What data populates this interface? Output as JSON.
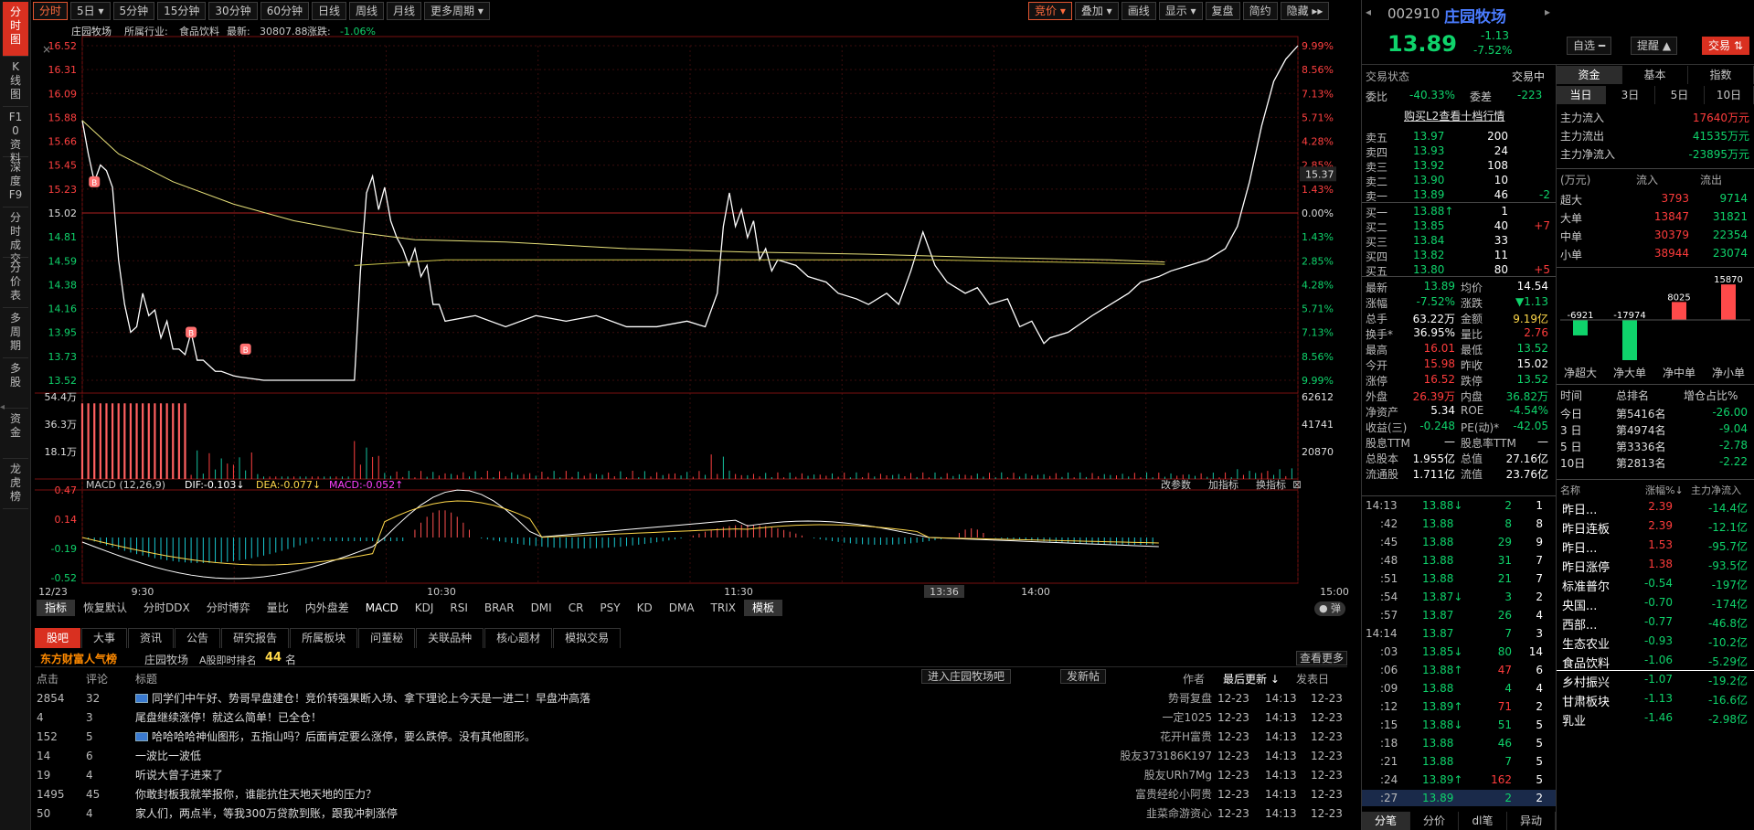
{
  "left_nav": [
    "分时图",
    "K线图",
    "F10资料",
    "深度F9",
    "分时成交",
    "分价表",
    "多周期",
    "多股",
    "资金",
    "龙虎榜"
  ],
  "toolbar": {
    "periods": [
      "分时",
      "5日 ▾",
      "5分钟",
      "15分钟",
      "30分钟",
      "60分钟",
      "日线",
      "周线",
      "月线",
      "更多周期 ▾"
    ],
    "right": [
      "竞价 ▾",
      "叠加 ▾",
      "画线",
      "显示 ▾",
      "复盘",
      "简约",
      "隐藏 ▸▸"
    ]
  },
  "chart_data": {
    "type": "line",
    "header": {
      "name": "庄园牧场",
      "industry_label": "所属行业:",
      "industry": "食品饮料",
      "latest_label": "最新:",
      "latest": "30807.88",
      "chg_label": "涨跌:",
      "chg": "-1.06%"
    },
    "price_ticks": [
      "16.52",
      "16.31",
      "16.09",
      "15.88",
      "15.66",
      "15.45",
      "15.23",
      "15.02",
      "14.81",
      "14.59",
      "14.38",
      "14.16",
      "13.95",
      "13.73",
      "13.52"
    ],
    "pct_ticks": [
      "9.99%",
      "8.56%",
      "7.13%",
      "5.71%",
      "4.28%",
      "2.85%",
      "1.43%",
      "0.00%",
      "1.43%",
      "2.85%",
      "4.28%",
      "5.71%",
      "7.13%",
      "8.56%",
      "9.99%"
    ],
    "ylim": [
      13.52,
      16.52
    ],
    "prev_close": 15.02,
    "cursor_label": "15.37",
    "vol_ticks": [
      "54.4万",
      "36.3万",
      "18.1万"
    ],
    "vol_right_ticks": [
      "62612",
      "41741",
      "20870"
    ],
    "macd": {
      "label": "MACD (12,26,9)",
      "dif": "DIF:-0.103↓",
      "dea": "DEA:-0.077↓",
      "macd": "MACD:-0.052↑",
      "ticks": [
        "0.47",
        "0.14",
        "-0.19",
        "-0.52"
      ],
      "links": [
        "改参数",
        "加指标",
        "换指标"
      ]
    },
    "x_labels": [
      "12/23",
      "9:30",
      "10:30",
      "11:30",
      "13:36",
      "14:00",
      "15:00"
    ],
    "series": [
      {
        "values": [
          [
            0,
            15.85
          ],
          [
            2,
            15.55
          ],
          [
            4,
            15.3
          ],
          [
            6,
            15.45
          ],
          [
            8,
            15.4
          ],
          [
            10,
            15.25
          ],
          [
            12,
            14.6
          ],
          [
            14,
            14.2
          ],
          [
            16,
            13.95
          ],
          [
            18,
            14.0
          ],
          [
            20,
            14.3
          ],
          [
            22,
            14.1
          ],
          [
            24,
            14.15
          ],
          [
            26,
            13.9
          ],
          [
            28,
            14.05
          ],
          [
            30,
            13.8
          ],
          [
            32,
            13.8
          ],
          [
            34,
            13.75
          ],
          [
            36,
            13.95
          ],
          [
            38,
            13.7
          ],
          [
            40,
            13.7
          ],
          [
            42,
            13.65
          ],
          [
            44,
            13.6
          ],
          [
            46,
            13.6
          ],
          [
            48,
            13.58
          ],
          [
            50,
            13.56
          ],
          [
            52,
            13.55
          ],
          [
            60,
            13.52
          ],
          [
            90,
            13.52
          ],
          [
            92,
            14.5
          ],
          [
            94,
            15.2
          ],
          [
            96,
            15.35
          ],
          [
            98,
            15.05
          ],
          [
            100,
            15.25
          ],
          [
            102,
            14.95
          ],
          [
            104,
            14.8
          ],
          [
            106,
            14.7
          ],
          [
            108,
            14.55
          ],
          [
            110,
            14.7
          ],
          [
            112,
            14.45
          ],
          [
            114,
            14.55
          ],
          [
            116,
            14.2
          ],
          [
            118,
            14.2
          ],
          [
            120,
            14.05
          ],
          [
            130,
            14.1
          ],
          [
            140,
            14.0
          ],
          [
            150,
            14.1
          ],
          [
            160,
            14.05
          ],
          [
            170,
            14.1
          ],
          [
            180,
            14.0
          ],
          [
            190,
            14.0
          ],
          [
            200,
            14.05
          ],
          [
            206,
            14.0
          ],
          [
            210,
            14.3
          ],
          [
            212,
            14.9
          ],
          [
            214,
            15.2
          ],
          [
            216,
            14.9
          ],
          [
            218,
            15.05
          ],
          [
            220,
            14.8
          ],
          [
            222,
            14.95
          ],
          [
            224,
            14.6
          ],
          [
            226,
            14.7
          ],
          [
            228,
            14.5
          ],
          [
            230,
            14.6
          ],
          [
            236,
            14.55
          ],
          [
            240,
            14.45
          ],
          [
            246,
            14.4
          ],
          [
            250,
            14.3
          ],
          [
            256,
            14.25
          ],
          [
            260,
            14.2
          ],
          [
            266,
            14.3
          ],
          [
            270,
            14.2
          ],
          [
            274,
            14.5
          ],
          [
            278,
            14.85
          ],
          [
            282,
            14.55
          ],
          [
            286,
            14.4
          ],
          [
            292,
            14.3
          ],
          [
            296,
            14.35
          ],
          [
            300,
            14.2
          ],
          [
            306,
            14.25
          ],
          [
            310,
            14.0
          ],
          [
            314,
            14.05
          ],
          [
            318,
            13.85
          ],
          [
            320,
            13.9
          ],
          [
            326,
            13.95
          ],
          [
            334,
            14.1
          ],
          [
            340,
            14.2
          ],
          [
            346,
            14.3
          ],
          [
            350,
            14.4
          ],
          [
            356,
            14.45
          ],
          [
            360,
            14.5
          ],
          [
            366,
            14.55
          ],
          [
            372,
            14.6
          ],
          [
            378,
            14.7
          ],
          [
            382,
            14.9
          ],
          [
            386,
            15.3
          ],
          [
            390,
            15.8
          ],
          [
            394,
            16.2
          ],
          [
            398,
            16.4
          ],
          [
            402,
            16.52
          ]
        ]
      },
      {
        "values": [
          [
            0,
            15.85
          ],
          [
            12,
            15.55
          ],
          [
            30,
            15.3
          ],
          [
            50,
            15.1
          ],
          [
            70,
            14.95
          ],
          [
            90,
            14.85
          ],
          [
            110,
            14.78
          ],
          [
            140,
            14.76
          ],
          [
            180,
            14.7
          ],
          [
            220,
            14.67
          ],
          [
            260,
            14.65
          ],
          [
            300,
            14.62
          ],
          [
            340,
            14.6
          ],
          [
            358,
            14.58
          ]
        ]
      },
      {
        "values": [
          [
            90,
            14.55
          ],
          [
            120,
            14.6
          ],
          [
            160,
            14.6
          ],
          [
            200,
            14.6
          ],
          [
            240,
            14.6
          ],
          [
            280,
            14.6
          ],
          [
            320,
            14.58
          ],
          [
            358,
            14.56
          ]
        ]
      }
    ],
    "buy_marks": [
      [
        4,
        15.3
      ],
      [
        36,
        13.95
      ],
      [
        54,
        13.8
      ]
    ]
  },
  "indicator_tabs": [
    "指标",
    "恢复默认",
    "分时DDX",
    "分时博弈",
    "量比",
    "内外盘差",
    "MACD",
    "KDJ",
    "RSI",
    "BRAR",
    "DMI",
    "CR",
    "PSY",
    "KD",
    "DMA",
    "TRIX",
    "模板"
  ],
  "bottom_tabs": [
    "股吧",
    "大事",
    "资讯",
    "公告",
    "研究报告",
    "所属板块",
    "问董秘",
    "关联品种",
    "核心题材",
    "模拟交易"
  ],
  "feed": {
    "brand": "东方财富人气榜",
    "stock": "庄园牧场",
    "rank_label": "A股即时排名",
    "rank": "44",
    "rank_unit": "名",
    "more": "查看更多",
    "headers": [
      "点击",
      "评论",
      "标题",
      "作者",
      "最后更新 ↓",
      "发表日"
    ],
    "enter": "进入庄园牧场吧",
    "post": "发新帖",
    "rows": [
      [
        "2854",
        "32",
        "同学们中午好、势哥早盘建仓！竞价转强果断入场、拿下理论上今天是一进二！早盘冲高落",
        "势哥复盘",
        "12-23",
        "14:13",
        "12-23"
      ],
      [
        "4",
        "3",
        "尾盘继续涨停！就这么简单！已全仓！",
        "一定1025",
        "12-23",
        "14:13",
        "12-23"
      ],
      [
        "152",
        "5",
        "哈哈哈哈神仙图形，五指山吗？后面肯定要么涨停，要么跌停。没有其他图形。",
        "花开H富贵",
        "12-23",
        "14:13",
        "12-23"
      ],
      [
        "14",
        "6",
        "一波比一波低",
        "股友373186K197",
        "12-23",
        "14:13",
        "12-23"
      ],
      [
        "19",
        "4",
        "听说大曾子进来了",
        "股友URh7Mg",
        "12-23",
        "14:13",
        "12-23"
      ],
      [
        "1495",
        "45",
        "你敢封板我就举报你，谁能抗住天地天地的压力？",
        "富贵经纶小阿贵",
        "12-23",
        "14:13",
        "12-23"
      ],
      [
        "50",
        "4",
        "家人们，两点半，等我300万贷款到账，跟我冲刺涨停",
        "韭菜命游资心",
        "12-23",
        "14:13",
        "12-23"
      ]
    ]
  },
  "quote": {
    "code": "002910",
    "name": "庄园牧场",
    "price": "13.89",
    "chg": "-1.13",
    "pct": "-7.52%",
    "btn_zx": "自选 ━",
    "btn_alert": "提醒 ▲",
    "btn_trade": "交易 ⇅",
    "status_label": "交易状态",
    "status": "交易中",
    "webi_label": "委比",
    "webi": "-40.33%",
    "wecha_label": "委差",
    "wecha": "-223",
    "l2": "购买L2查看十档行情",
    "asks": [
      [
        "卖五",
        "13.97",
        "200",
        ""
      ],
      [
        "卖四",
        "13.93",
        "24",
        ""
      ],
      [
        "卖三",
        "13.92",
        "108",
        ""
      ],
      [
        "卖二",
        "13.90",
        "10",
        ""
      ],
      [
        "卖一",
        "13.89",
        "46",
        "-2"
      ]
    ],
    "bids": [
      [
        "买一",
        "13.88↑",
        "1",
        ""
      ],
      [
        "买二",
        "13.85",
        "40",
        "+7"
      ],
      [
        "买三",
        "13.84",
        "33",
        ""
      ],
      [
        "买四",
        "13.82",
        "11",
        ""
      ],
      [
        "买五",
        "13.80",
        "80",
        "+5"
      ]
    ],
    "stats": [
      [
        "最新",
        "13.89",
        "均价",
        "14.54"
      ],
      [
        "涨幅",
        "-7.52%",
        "涨跌",
        "▼1.13"
      ],
      [
        "总手",
        "63.22万",
        "金额",
        "9.19亿"
      ],
      [
        "换手*",
        "36.95%",
        "量比",
        "2.76"
      ],
      [
        "最高",
        "16.01",
        "最低",
        "13.52"
      ],
      [
        "今开",
        "15.98",
        "昨收",
        "15.02"
      ],
      [
        "涨停",
        "16.52",
        "跌停",
        "13.52"
      ],
      [
        "外盘",
        "26.39万",
        "内盘",
        "36.82万"
      ],
      [
        "净资产",
        "5.34",
        "ROE",
        "-4.54%"
      ],
      [
        "收益(三)",
        "-0.248",
        "PE(动)*",
        "-42.05"
      ],
      [
        "股息TTM",
        "—",
        "股息率TTM",
        "—"
      ],
      [
        "总股本",
        "1.955亿",
        "总值",
        "27.16亿"
      ],
      [
        "流通股",
        "1.711亿",
        "流值",
        "23.76亿"
      ]
    ]
  },
  "ticks": [
    [
      "14:13",
      "13.88↓",
      "2",
      "1"
    ],
    [
      ":42",
      "13.88",
      "8",
      "8"
    ],
    [
      ":45",
      "13.88",
      "29",
      "9"
    ],
    [
      ":48",
      "13.88",
      "31",
      "7"
    ],
    [
      ":51",
      "13.88",
      "21",
      "7"
    ],
    [
      ":54",
      "13.87↓",
      "3",
      "2"
    ],
    [
      ":57",
      "13.87",
      "26",
      "4"
    ],
    [
      "14:14",
      "13.87",
      "7",
      "3"
    ],
    [
      ":03",
      "13.85↓",
      "80",
      "14"
    ],
    [
      ":06",
      "13.88↑",
      "47",
      "6"
    ],
    [
      ":09",
      "13.88",
      "4",
      "4"
    ],
    [
      ":12",
      "13.89↑",
      "71",
      "2"
    ],
    [
      ":15",
      "13.88↓",
      "51",
      "5"
    ],
    [
      ":18",
      "13.88",
      "46",
      "5"
    ],
    [
      ":21",
      "13.88",
      "7",
      "5"
    ],
    [
      ":24",
      "13.89↑",
      "162",
      "5"
    ],
    [
      ":27",
      "13.89",
      "2",
      "2"
    ]
  ],
  "tick_tabs": [
    "分笔",
    "分价",
    "dl笔",
    "异动"
  ],
  "funds": {
    "tabs": [
      "资金",
      "基本",
      "指数"
    ],
    "subtabs": [
      "当日",
      "3日",
      "5日",
      "10日"
    ],
    "flows": [
      [
        "主力流入",
        "17640万元"
      ],
      [
        "主力流出",
        "41535万元"
      ],
      [
        "主力净流入",
        "-23895万元"
      ]
    ],
    "tbl_head": [
      "(万元)",
      "流入",
      "流出"
    ],
    "tbl": [
      [
        "超大",
        "3793",
        "9714"
      ],
      [
        "大单",
        "13847",
        "31821"
      ],
      [
        "中单",
        "30379",
        "22354"
      ],
      [
        "小单",
        "38944",
        "23074"
      ]
    ],
    "net_values": [
      -6921,
      -17974,
      8025,
      15870
    ],
    "net_labels": [
      "-6921",
      "-17974",
      "8025",
      "15870"
    ],
    "net_names": [
      "净超大",
      "净大单",
      "净中单",
      "净小单"
    ],
    "rank_head": [
      "时间",
      "总排名",
      "增仓占比%"
    ],
    "rank": [
      [
        "今日",
        "第5416名",
        "-26.00"
      ],
      [
        "3 日",
        "第4974名",
        "-9.04"
      ],
      [
        "5 日",
        "第3336名",
        "-2.78"
      ],
      [
        "10日",
        "第2813名",
        "-2.22"
      ]
    ],
    "sector_head": [
      "名称",
      "涨幅%↓",
      "主力净流入"
    ],
    "sectors": [
      [
        "昨日...",
        "2.39",
        "-14.4亿"
      ],
      [
        "昨日连板",
        "2.39",
        "-12.1亿"
      ],
      [
        "昨日...",
        "1.53",
        "-95.7亿"
      ],
      [
        "昨日涨停",
        "1.38",
        "-93.5亿"
      ],
      [
        "标准普尔",
        "-0.54",
        "-197亿"
      ],
      [
        "央国...",
        "-0.70",
        "-174亿"
      ],
      [
        "西部...",
        "-0.77",
        "-46.8亿"
      ],
      [
        "生态农业",
        "-0.93",
        "-10.2亿"
      ],
      [
        "食品饮料",
        "-1.06",
        "-5.29亿"
      ],
      [
        "乡村振兴",
        "-1.07",
        "-19.2亿"
      ],
      [
        "甘肃板块",
        "-1.13",
        "-16.6亿"
      ],
      [
        "乳业",
        "-1.46",
        "-2.98亿"
      ]
    ]
  }
}
